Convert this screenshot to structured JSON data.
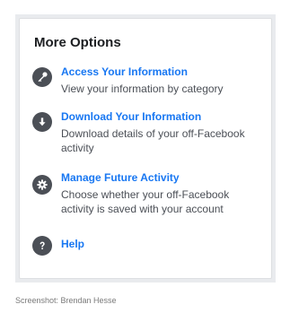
{
  "panel": {
    "title": "More Options",
    "options": [
      {
        "title": "Access Your Information",
        "description": "View your information by category",
        "icon": "key-icon"
      },
      {
        "title": "Download Your Information",
        "description": "Download details of your off-Facebook activity",
        "icon": "download-icon"
      },
      {
        "title": "Manage Future Activity",
        "description": "Choose whether your off-Facebook activity is saved with your account",
        "icon": "gear-icon"
      },
      {
        "title": "Help",
        "description": "",
        "icon": "question-icon"
      }
    ]
  },
  "caption": "Screenshot: Brendan Hesse",
  "colors": {
    "link": "#1877f2",
    "icon_bg": "#4b4f56",
    "frame_bg": "#e9ebee"
  }
}
